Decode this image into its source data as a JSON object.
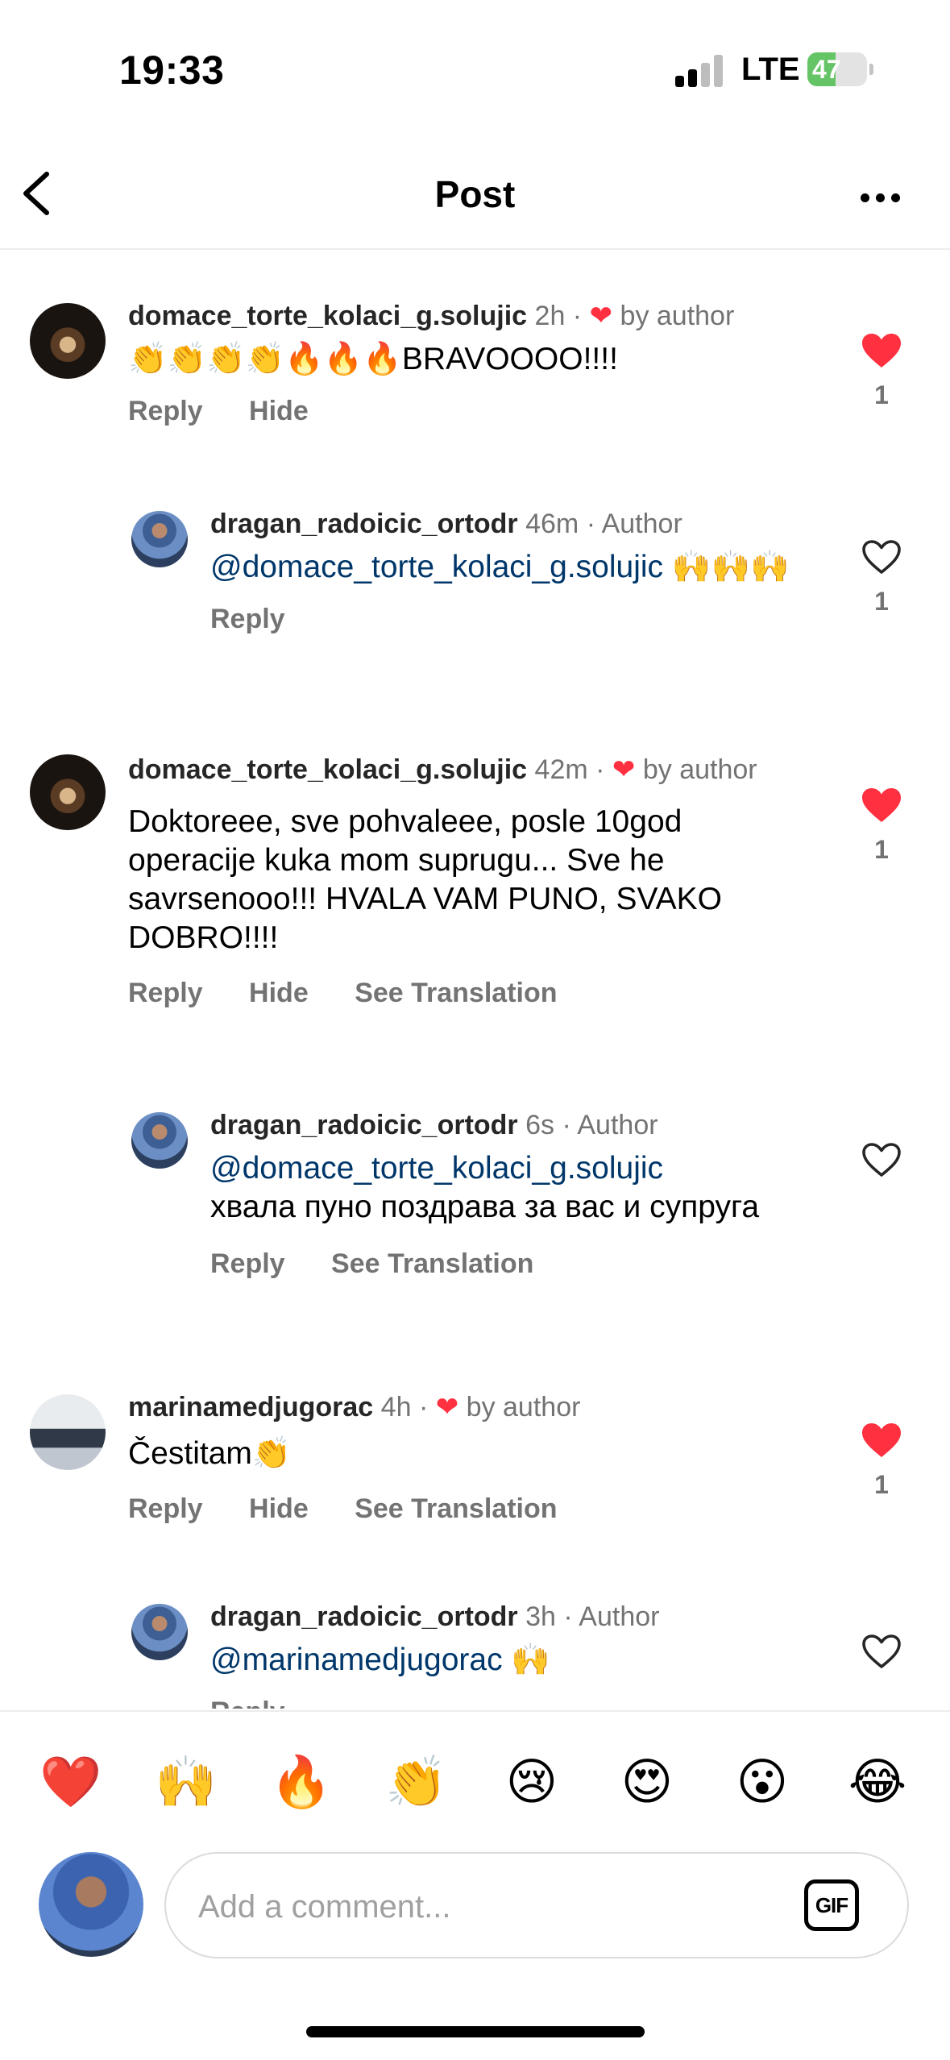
{
  "status_bar": {
    "time": "19:33",
    "network": "LTE",
    "battery_level": "47",
    "battery_color": "#65c466"
  },
  "header": {
    "title": "Post",
    "back_icon": "chevron-left-icon",
    "more_icon": "more-horizontal-icon"
  },
  "comments": [
    {
      "username": "domace_torte_kolaci_g.solujic",
      "time": "2h",
      "meta_suffix": "by author",
      "text": "👏👏👏👏🔥🔥🔥BRAVOOOO!!!!",
      "actions": [
        "Reply",
        "Hide"
      ],
      "liked": true,
      "like_count": "1"
    },
    {
      "username": "dragan_radoicic_ortodr",
      "time": "46m",
      "meta_suffix": "Author",
      "mention": "@domace_torte_kolaci_g.solujic",
      "text": " 🙌🙌🙌",
      "actions": [
        "Reply"
      ],
      "liked": false,
      "like_count": "1"
    },
    {
      "username": "domace_torte_kolaci_g.solujic",
      "time": "42m",
      "meta_suffix": "by author",
      "text": "Doktoreee, sve pohvaleee, posle 10god operacije kuka mom suprugu... Sve he savrsenooo!!! HVALA VAM PUNO, SVAKO DOBRO!!!!",
      "actions": [
        "Reply",
        "Hide",
        "See Translation"
      ],
      "liked": true,
      "like_count": "1"
    },
    {
      "username": "dragan_radoicic_ortodr",
      "time": "6s",
      "meta_suffix": "Author",
      "mention": "@domace_torte_kolaci_g.solujic",
      "text": "хвала пуно поздрава за вас и супруга",
      "actions": [
        "Reply",
        "See Translation"
      ],
      "liked": false,
      "like_count": ""
    },
    {
      "username": "marinamedjugorac",
      "time": "4h",
      "meta_suffix": "by author",
      "text": "Čestitam👏",
      "actions": [
        "Reply",
        "Hide",
        "See Translation"
      ],
      "liked": true,
      "like_count": "1"
    },
    {
      "username": "dragan_radoicic_ortodr",
      "time": "3h",
      "meta_suffix": "Author",
      "mention": "@marinamedjugorac",
      "text": " 🙌",
      "actions": [
        "Reply"
      ],
      "liked": false,
      "like_count": ""
    }
  ],
  "emoji_bar": [
    "❤️",
    "🙌",
    "🔥",
    "👏",
    "😢",
    "😍",
    "😮",
    "😂"
  ],
  "composer": {
    "placeholder": "Add a comment...",
    "gif_label": "GIF"
  },
  "colors": {
    "like_red": "#ff3040",
    "mention_blue": "#00376b",
    "meta_gray": "#737373"
  }
}
